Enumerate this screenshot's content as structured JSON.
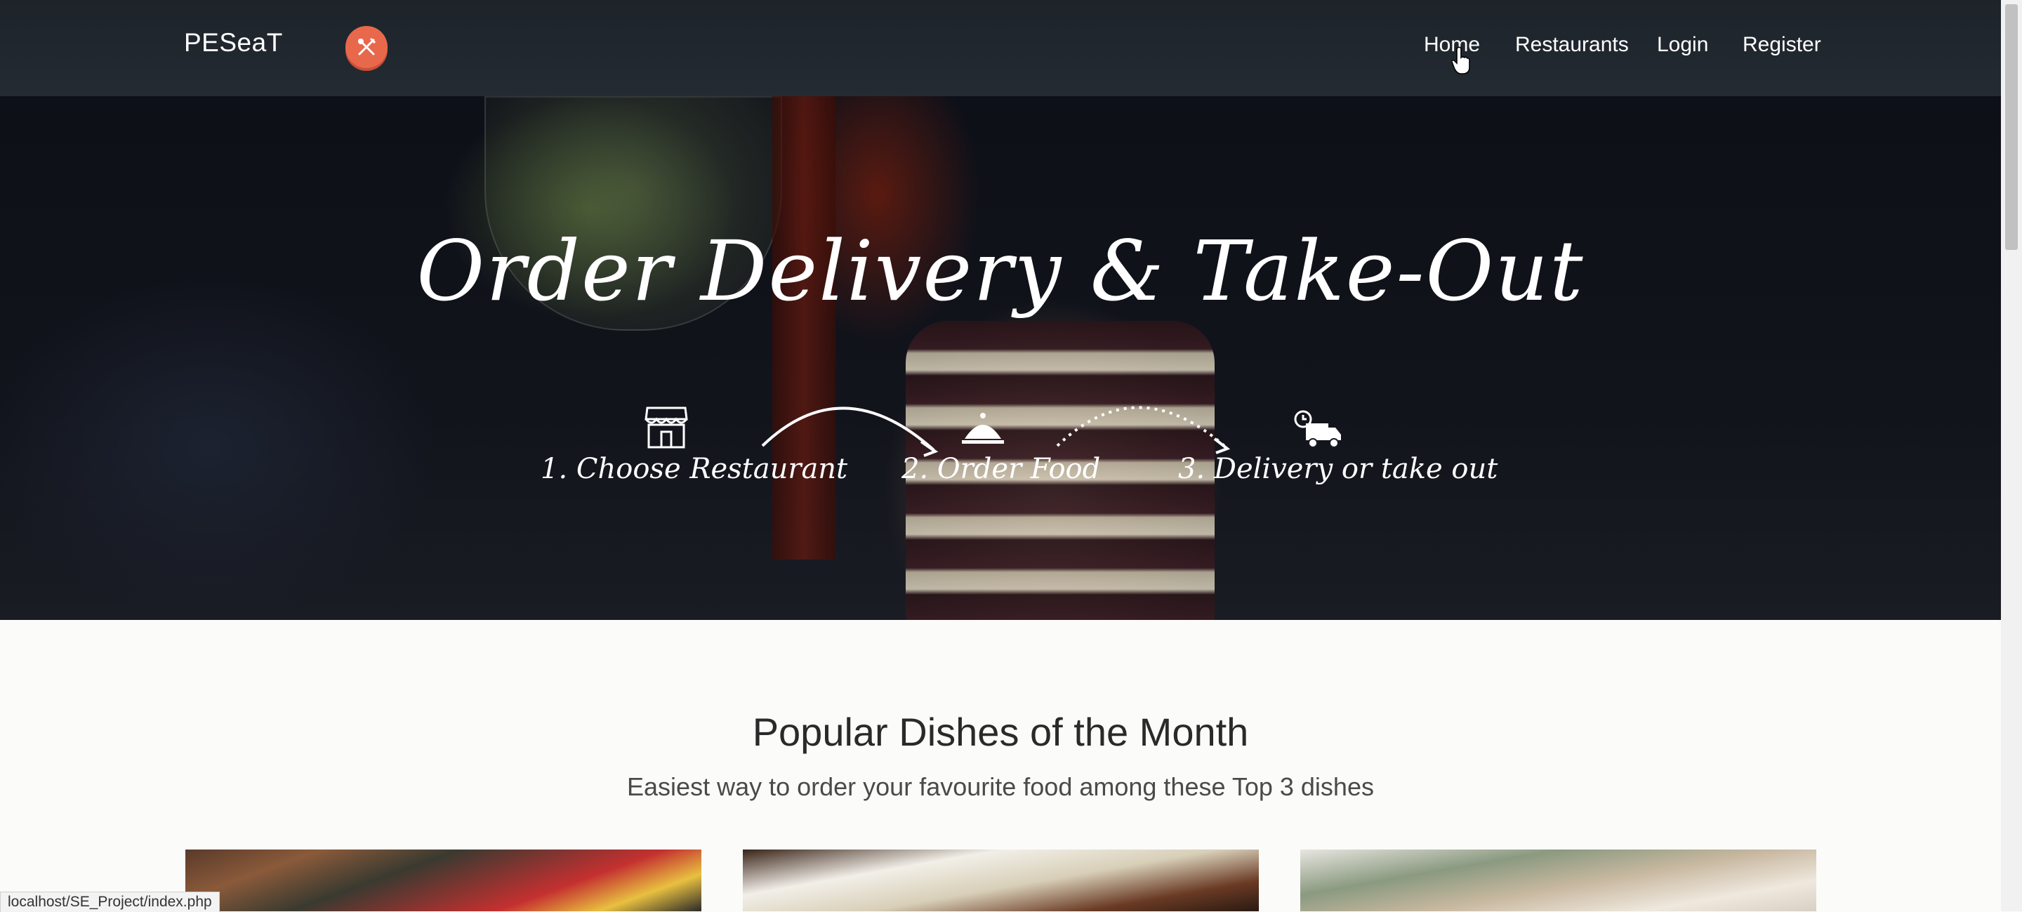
{
  "navbar": {
    "brand": "PESeaT",
    "links": [
      "Home",
      "Restaurants",
      "Login",
      "Register"
    ]
  },
  "hero": {
    "title": "Order Delivery & Take-Out",
    "steps": [
      {
        "label": "1. Choose Restaurant",
        "icon": "store-icon"
      },
      {
        "label": "2. Order Food",
        "icon": "cloche-icon"
      },
      {
        "label": "3. Delivery or take out",
        "icon": "delivery-truck-icon"
      }
    ]
  },
  "popular": {
    "title": "Popular Dishes of the Month",
    "subtitle": "Easiest way to order your favourite food among these Top 3 dishes"
  },
  "status_bar": {
    "url": "localhost/SE_Project/index.php"
  },
  "colors": {
    "nav_bg": "#1f262d",
    "logo": "#e8684c",
    "page_bg": "#fbfbf9"
  }
}
